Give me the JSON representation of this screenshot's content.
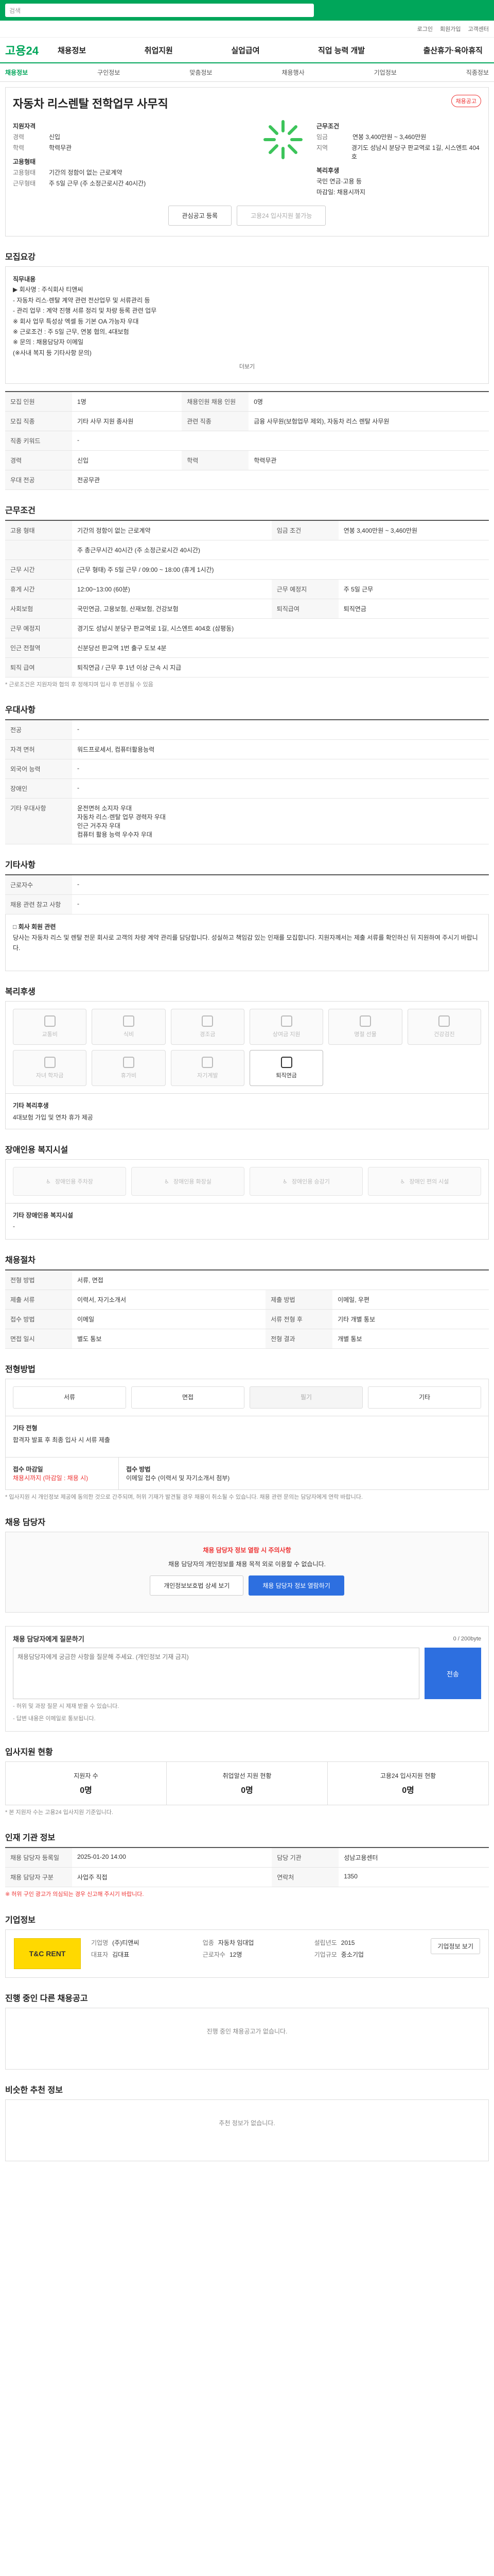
{
  "header": {
    "search_placeholder": "검색",
    "util": [
      "로그인",
      "회원가입",
      "고객센터"
    ],
    "logo": "고용24",
    "gnb": [
      "채용정보",
      "취업지원",
      "실업급여",
      "직업 능력 개발",
      "출산휴가·육아휴직"
    ],
    "lnb": [
      "채용정보",
      "구인정보",
      "맞춤정보",
      "채용행사",
      "기업정보",
      "직종정보"
    ]
  },
  "company": {
    "title": "자동차 리스렌탈 전학업무 사무직",
    "badge": "채용공고",
    "section_label": "지원자격",
    "rows": [
      {
        "k": "경력",
        "v": "신입"
      },
      {
        "k": "학력",
        "v": "학력무관"
      }
    ],
    "cond_label": "근무조건",
    "cond_rows": [
      {
        "k": "임금",
        "v": "연봉 3,400만원 ~ 3,460만원"
      },
      {
        "k": "지역",
        "v": "경기도 성남시 분당구 판교역로 1길, 시스엔트 404호"
      }
    ],
    "type_label": "고용형태",
    "type_rows": [
      {
        "k": "고용형태",
        "v": "기간의 정함이 없는 근로계약"
      },
      {
        "k": "근무형태",
        "v": "주 5일 근무 (주 소정근로시간 40시간)"
      }
    ],
    "welfare_label": "복리후생",
    "welfare_value": "국민 연금·고용 등",
    "deadline": "마감일: 채용시까지",
    "btn_interest": "관심공고 등록",
    "btn_apply": "고용24 입사지원 불가능"
  },
  "summary": {
    "title": "모집요강",
    "heading": "직무내용",
    "lines": [
      "▶ 회사명 : 주식회사 티앤씨",
      "- 자동차 리스·렌탈 계약 관련 전산업무 및 서류관리 등",
      "- 관리 업무 : 계약 진행 서류 정리 및 차량 등록 관련 업무",
      "※ 회사 업무 특성상 엑셀 등 기본 OA 가능자 우대",
      "※ 근로조건 : 주 5일 근무, 연봉 협의, 4대보험",
      "※ 문의 : 채용담당자 이메일",
      "(※사내 복지 등 기타사항 문의)"
    ],
    "more": "더보기"
  },
  "info_table": {
    "rows": [
      {
        "k": "모집 인원",
        "v": "1명",
        "k2": "채용인원 채용 인원",
        "v2": "0명"
      },
      {
        "k": "모집 직종",
        "v": "기타 사무 지원 종사원",
        "k2": "관련 직종",
        "v2": "금융 사무원(보험업무 제외), 자동차 리스 렌탈 사무원"
      },
      {
        "k": "직종 키워드",
        "v": "-",
        "k2": "",
        "v2": ""
      },
      {
        "k": "경력",
        "v": "신입",
        "k2": "학력",
        "v2": "학력무관"
      },
      {
        "k": "우대 전공",
        "v": "전공무관",
        "k2": "",
        "v2": ""
      }
    ]
  },
  "conditions": {
    "title": "근무조건",
    "rows": [
      {
        "k": "고용 형태",
        "v": "기간의 정함이 없는 근로계약",
        "k2": "임금 조건",
        "v2": "연봉 3,400만원 ~ 3,460만원"
      },
      {
        "k": "",
        "v": "주 총근무시간 40시간 (주 소정근로시간 40시간)",
        "k2": "",
        "v2": ""
      },
      {
        "k": "근무 시간",
        "v": "(근무 형태) 주 5일 근무 / 09:00 ~ 18:00 (휴게 1시간)",
        "k2": "",
        "v2": ""
      },
      {
        "k": "휴게 시간",
        "v": "12:00~13:00 (60분)",
        "k2": "근무 예정지",
        "v2": "주 5일 근무"
      },
      {
        "k": "사회보험",
        "v": "국민연금, 고용보험, 산재보험, 건강보험",
        "k2": "퇴직급여",
        "v2": "퇴직연금"
      },
      {
        "k": "근무 예정지",
        "v": "경기도 성남시 분당구 판교역로 1길, 시스엔트 404호 (삼평동)",
        "k2": "",
        "v2": ""
      },
      {
        "k": "인근 전철역",
        "v": "신분당선 판교역 1번 출구 도보 4분",
        "k2": "",
        "v2": ""
      },
      {
        "k": "퇴직 급여",
        "v": "퇴직연금 / 근무 후 1년 이상 근속 시 지급",
        "k2": "",
        "v2": ""
      }
    ],
    "note": "* 근로조건은 지원자와 협의 후 정해지며 입사 후 변경될 수 있음"
  },
  "requirements": {
    "title": "우대사항",
    "rows": [
      {
        "k": "전공",
        "v": "-"
      },
      {
        "k": "자격 면허",
        "v": "워드프로세서, 컴퓨터활용능력"
      },
      {
        "k": "외국어 능력",
        "v": "-"
      },
      {
        "k": "장애인",
        "v": "-"
      },
      {
        "k": "기타 우대사항",
        "v": "운전면허 소지자 우대\n자동차 리스·렌탈 업무 경력자 우대\n인근 거주자 우대\n컴퓨터 활용 능력 우수자 우대"
      }
    ]
  },
  "extra": {
    "title": "기타사항",
    "rows": [
      {
        "k": "근로자수",
        "v": "-"
      },
      {
        "k": "채용 관련 참고 사항",
        "v": "-"
      }
    ],
    "box_title": "□ 회사 회원 관련",
    "box_text": "당사는 자동차 리스 및 렌탈 전문 회사로 고객의 차량 계약 관리를 담당합니다. 성실하고 책임감 있는 인재를 모집합니다. 지원자께서는 제출 서류를 확인하신 뒤 지원하여 주시기 바랍니다."
  },
  "welfare": {
    "title": "복리후생",
    "items": [
      {
        "label": "교통비",
        "on": false
      },
      {
        "label": "식비",
        "on": false
      },
      {
        "label": "경조금",
        "on": false
      },
      {
        "label": "상여금 지원",
        "on": false
      },
      {
        "label": "명절 선물",
        "on": false
      },
      {
        "label": "건강검진",
        "on": false
      },
      {
        "label": "자녀 학자금",
        "on": false
      },
      {
        "label": "휴가비",
        "on": false
      },
      {
        "label": "자기계발",
        "on": false
      },
      {
        "label": "퇴직연금",
        "on": true
      }
    ],
    "sub_title": "기타 복리후생",
    "sub_text": "4대보험 가입 및 연차 휴가 제공"
  },
  "disability": {
    "title": "장애인용 복지시설",
    "items": [
      "장애인용 주차장",
      "장애인용 화장실",
      "장애인용 승강기",
      "장애인 편의 시설"
    ],
    "sub_title": "기타 장애인용 복지시설",
    "sub_text": "-"
  },
  "process": {
    "title": "채용절차",
    "rows": [
      {
        "k": "전형 방법",
        "v": "서류, 면접",
        "k2": "",
        "v2": ""
      },
      {
        "k": "제출 서류",
        "v": "이력서, 자기소개서",
        "k2": "제출 방법",
        "v2": "이메일, 우편"
      },
      {
        "k": "접수 방법",
        "v": "이메일",
        "k2": "서류 전형 후",
        "v2": "기타 개별 통보"
      },
      {
        "k": "면접 일시",
        "v": "별도 통보",
        "k2": "전형 결과",
        "v2": "개별 통보"
      }
    ]
  },
  "method": {
    "title": "전형방법",
    "items": [
      {
        "label": "서류",
        "dim": false
      },
      {
        "label": "면접",
        "dim": false
      },
      {
        "label": "필기",
        "dim": true
      },
      {
        "label": "기타",
        "dim": false
      }
    ],
    "sub_title": "기타 전형",
    "sub_text": "합격자 발표 후 최종 입사 시 서류 제출",
    "apply_k": "접수 마감일",
    "apply_v": "채용시까지 (마감일 : 채용 시)",
    "apply_k2": "접수 방법",
    "apply_v2": "이메일 접수 (이력서 및 자기소개서 첨부)",
    "note": "* 입사지원 시 개인정보 제공에 동의한 것으로 간주되며, 허위 기재가 발견될 경우 채용이 취소될 수 있습니다. 채용 관련 문의는 담당자에게 연락 바랍니다."
  },
  "contact": {
    "title": "채용 담당자",
    "warn": "채용 담당자 정보 열람 시 주의사항",
    "text": "채용 담당자의 개인정보를 채용 목적 외로 이용할 수 없습니다.",
    "btn1": "개인정보보호법 상세 보기",
    "btn2": "채용 담당자 정보 열람하기"
  },
  "qna": {
    "title": "채용 담당자에게 질문하기",
    "count": "0 / 200byte",
    "placeholder": "채용담당자에게 궁금한 사항을 질문해 주세요. (개인정보 기재 금지)",
    "send": "전송",
    "notes": [
      "- 허위 및 과장 질문 시 제재 받을 수 있습니다.",
      "- 답변 내용은 이메일로 통보됩니다."
    ]
  },
  "status": {
    "title": "입사지원 현황",
    "items": [
      {
        "label": "지원자 수",
        "value": "0명"
      },
      {
        "label": "취업알선 지원 현황",
        "value": "0명"
      },
      {
        "label": "고용24 입사지원 현황",
        "value": "0명"
      }
    ],
    "note": "* 본 지원자 수는 고용24 입사지원 기준입니다."
  },
  "manage": {
    "title": "인재 기관 정보",
    "rows": [
      {
        "k": "채용 담당자 등록일",
        "v": "2025-01-20 14:00",
        "k2": "담당 기관",
        "v2": "성남고용센터"
      },
      {
        "k": "채용 담당자 구분",
        "v": "사업주 직접",
        "k2": "연락처",
        "v2": "1350"
      }
    ],
    "note": "※ 허위 구인 광고가 의심되는 경우 신고해 주시기 바랍니다."
  },
  "corp": {
    "title": "기업정보",
    "logo": "T&C RENT",
    "rows": [
      {
        "k": "기업명",
        "v": "(주)티앤씨"
      },
      {
        "k": "업종",
        "v": "자동차 임대업"
      },
      {
        "k": "설립년도",
        "v": "2015"
      },
      {
        "k": "대표자",
        "v": "김대표"
      },
      {
        "k": "근로자수",
        "v": "12명"
      },
      {
        "k": "기업규모",
        "v": "중소기업"
      }
    ],
    "btn": "기업정보 보기"
  },
  "ongoing": {
    "title": "진행 중인 다른 채용공고",
    "empty": "진행 중인 채용공고가 없습니다."
  },
  "similar": {
    "title": "비슷한 추천 정보",
    "empty": "추천 정보가 없습니다."
  }
}
